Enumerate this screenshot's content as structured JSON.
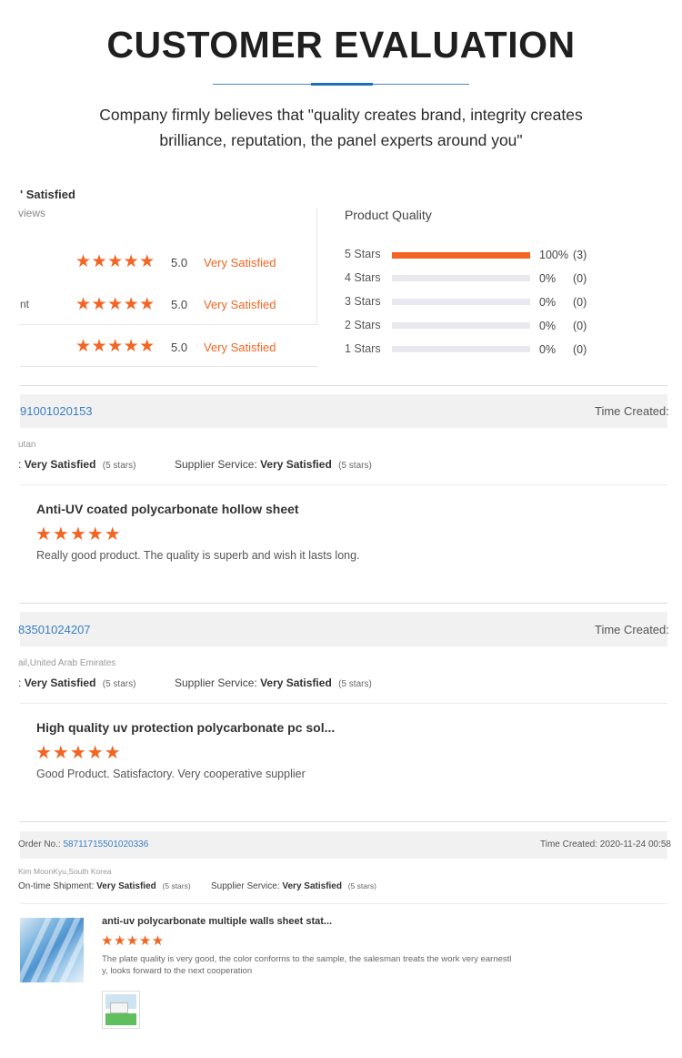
{
  "header": {
    "title": "CUSTOMER EVALUATION",
    "subtitle_line1": "Company firmly believes that \"quality creates brand, integrity creates",
    "subtitle_line2": "brilliance, reputation, the panel experts around you\""
  },
  "summary": {
    "title": "Satisfied",
    "subtitle": "views",
    "rows": [
      {
        "label": "",
        "stars": "★★★★★",
        "score": "5.0",
        "status": "Very Satisfied"
      },
      {
        "label": "nt",
        "stars": "★★★★★",
        "score": "5.0",
        "status": "Very Satisfied"
      },
      {
        "label": "",
        "stars": "★★★★★",
        "score": "5.0",
        "status": "Very Satisfied"
      }
    ]
  },
  "product_quality": {
    "title": "Product Quality",
    "rows": [
      {
        "label": "5 Stars",
        "fraction": 1.0,
        "percent": "100%",
        "count": "(3)"
      },
      {
        "label": "4 Stars",
        "fraction": 0.0,
        "percent": "0%",
        "count": "(0)"
      },
      {
        "label": "3 Stars",
        "fraction": 0.0,
        "percent": "0%",
        "count": "(0)"
      },
      {
        "label": "2 Stars",
        "fraction": 0.0,
        "percent": "0%",
        "count": "(0)"
      },
      {
        "label": "1 Stars",
        "fraction": 0.0,
        "percent": "0%",
        "count": "(0)"
      }
    ]
  },
  "reviews": [
    {
      "order_no": "91001020153",
      "time_created": "Time Created:",
      "buyer": "utan",
      "shipment_label": ":",
      "shipment_value": "Very Satisfied",
      "shipment_stars": "(5 stars)",
      "service_label": "Supplier Service:",
      "service_value": "Very Satisfied",
      "service_stars": "(5 stars)",
      "product": "Anti-UV coated polycarbonate hollow sheet",
      "stars": "★★★★★",
      "comment": "Really good product. The quality is superb and wish it lasts long."
    },
    {
      "order_no": "83501024207",
      "time_created": "Time Created:",
      "buyer": "ail,United Arab Emirates",
      "shipment_label": ":",
      "shipment_value": "Very Satisfied",
      "shipment_stars": "(5 stars)",
      "service_label": "Supplier Service:",
      "service_value": "Very Satisfied",
      "service_stars": "(5 stars)",
      "product": "High quality uv protection polycarbonate pc sol...",
      "stars": "★★★★★",
      "comment": "Good Product. Satisfactory. Very cooperative supplier"
    },
    {
      "order_label": "Order No.:",
      "order_no": "58711715501020336",
      "time_created": "Time Created: 2020-11-24 00:58",
      "buyer": "Kim MoonKyu,South Korea",
      "shipment_label": "On-time Shipment:",
      "shipment_value": "Very Satisfied",
      "shipment_stars": "(5 stars)",
      "service_label": "Supplier Service:",
      "service_value": "Very Satisfied",
      "service_stars": "(5 stars)",
      "product": "anti-uv polycarbonate multiple walls sheet stat...",
      "stars": "★★★★★",
      "comment_line1": "The plate quality is very good, the color conforms to the sample, the salesman treats the work very earnestl",
      "comment_line2": "y, looks forward to the next cooperation"
    }
  ],
  "colors": {
    "accent": "#f26522",
    "link": "#3a7fc1",
    "rule": "#1f6fb8"
  }
}
